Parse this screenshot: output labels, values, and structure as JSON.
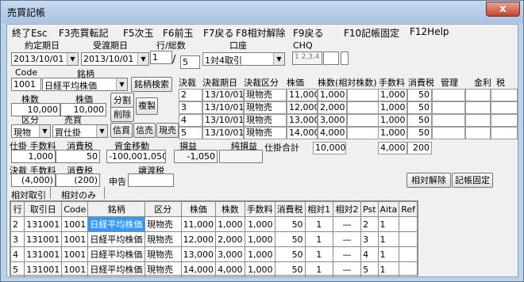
{
  "window": {
    "title": "売買記帳",
    "close": "x"
  },
  "menu": [
    "終了Esc",
    "F3売買転記",
    "F5次玉",
    "F6前玉",
    "F7戻る",
    "F8相対解除",
    "F9戻る",
    "F10記帳固定",
    "F12Help"
  ],
  "form": {
    "contract_date_label": "約定期日",
    "contract_date": "2013/10/01",
    "delivery_date_label": "受渡期日",
    "delivery_date": "2013/10/01",
    "row_total_label": "行/総数",
    "row": "1",
    "total": "5",
    "account_label": "口座",
    "account": "1対4取引",
    "chq_label": "CHQ",
    "chq_value": "1 2,3,4",
    "code_label": "Code",
    "code": "1001",
    "name_label": "銘柄",
    "name": "日経平均株価",
    "search_btn": "銘柄検索",
    "qty_label": "株数",
    "qty": "10,000",
    "price_label": "株価",
    "price": "10,000",
    "split_btn": "分割",
    "delete_btn": "削除",
    "copy_btn": "複製",
    "kubun_label": "区分",
    "kubun": "現物",
    "baibai_label": "売買",
    "baibai": "買仕掛",
    "credit_buy_btn": "信買",
    "credit_sell_btn": "信売",
    "genbai_btn": "現売",
    "pos_fee_label": "仕掛 手数料",
    "pos_tax_label": "消費税",
    "cash_label": "資金移動",
    "pos_fee": "1,000",
    "pos_tax": "50",
    "cash": "-100,001,050",
    "pl_label": "損益",
    "net_pl_label": "純損益",
    "pl": "-1,050",
    "set_fee_label": "決裁 手数料",
    "set_tax_label": "消費税",
    "transfer_tax_label": "譲渡税",
    "set_fee": "(4,000)",
    "set_tax": "(200)",
    "declare_label": "申告",
    "relative_release_btn": "相対解除",
    "fix_btn": "記帳固定"
  },
  "settle": {
    "headers": [
      "決裁",
      "決裁期日",
      "決裁区分",
      "株価",
      "株数",
      "(相対株数)",
      "手数料",
      "消費税",
      "管理",
      "金利",
      "税"
    ],
    "rows": [
      [
        "2",
        "13/10/01",
        "現物売",
        "11,000",
        "1,000",
        "",
        "1,000",
        "50",
        "",
        "",
        ""
      ],
      [
        "3",
        "13/10/01",
        "現物売",
        "12,000",
        "2,000",
        "",
        "1,000",
        "50",
        "",
        "",
        ""
      ],
      [
        "4",
        "13/10/01",
        "現物売",
        "13,000",
        "3,000",
        "",
        "1,000",
        "50",
        "",
        "",
        ""
      ],
      [
        "5",
        "13/10/01",
        "現物売",
        "14,000",
        "4,000",
        "",
        "1,000",
        "50",
        "",
        "",
        ""
      ]
    ],
    "total_label": "仕掛合計",
    "total_qty": "10,000",
    "total_fee": "4,000",
    "total_tax": "200"
  },
  "tabs": [
    "相対取引",
    "相対のみ"
  ],
  "grid": {
    "headers": [
      "行",
      "取引日",
      "Code",
      "銘柄",
      "区分",
      "株価",
      "株数",
      "手数料",
      "消費税",
      "相対1",
      "相対2",
      "Pst",
      "Aita",
      "Ref"
    ],
    "rows": [
      [
        "2",
        "131001",
        "1001",
        "日経平均株価",
        "現物売",
        "11,000",
        "1,000",
        "1,000",
        "50",
        "1",
        "—",
        "2",
        "1",
        ""
      ],
      [
        "3",
        "131001",
        "1001",
        "日経平均株価",
        "現物売",
        "12,000",
        "2,000",
        "1,000",
        "50",
        "1",
        "—",
        "3",
        "1",
        ""
      ],
      [
        "4",
        "131001",
        "1001",
        "日経平均株価",
        "現物売",
        "13,000",
        "3,000",
        "1,000",
        "50",
        "1",
        "—",
        "4",
        "1",
        ""
      ],
      [
        "5",
        "131001",
        "1001",
        "日経平均株価",
        "現物売",
        "14,000",
        "4,000",
        "1,000",
        "50",
        "1",
        "—",
        "5",
        "1",
        ""
      ]
    ]
  }
}
